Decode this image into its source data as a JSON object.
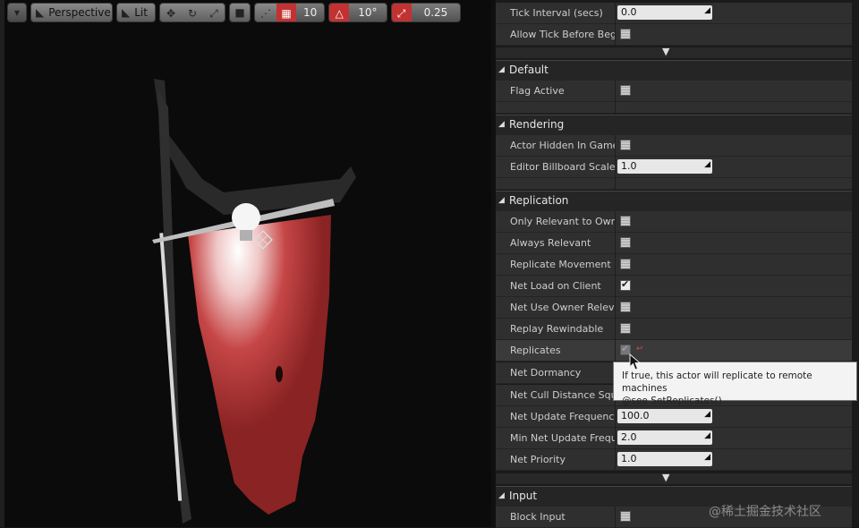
{
  "viewport": {
    "view_mode": "Perspective",
    "lit_mode": "Lit",
    "grid_snap": "10",
    "rotation_snap": "10°",
    "scale_snap": "0.25"
  },
  "details": {
    "top_rows": [
      {
        "label": "Tick Interval (secs)",
        "value": "0.0"
      },
      {
        "label": "Allow Tick Before Begin",
        "checked": false
      }
    ],
    "sections": {
      "default": {
        "title": "Default",
        "rows": [
          {
            "label": "Flag Active"
          }
        ]
      },
      "rendering": {
        "title": "Rendering",
        "rows": [
          {
            "label": "Actor Hidden In Game"
          },
          {
            "label": "Editor Billboard Scale",
            "value": "1.0"
          }
        ]
      },
      "replication": {
        "title": "Replication",
        "rows": [
          {
            "label": "Only Relevant to Owner"
          },
          {
            "label": "Always Relevant"
          },
          {
            "label": "Replicate Movement"
          },
          {
            "label": "Net Load on Client",
            "checked": true
          },
          {
            "label": "Net Use Owner Relevancy"
          },
          {
            "label": "Replay Rewindable"
          },
          {
            "label": "Replicates",
            "checked": true
          },
          {
            "label": "Net Dormancy"
          },
          {
            "label": "Net Cull Distance Squared"
          },
          {
            "label": "Net Update Frequency",
            "value": "100.0"
          },
          {
            "label": "Min Net Update Frequency",
            "value": "2.0"
          },
          {
            "label": "Net Priority",
            "value": "1.0"
          }
        ]
      },
      "input": {
        "title": "Input",
        "rows": [
          {
            "label": "Block Input"
          }
        ]
      }
    }
  },
  "tooltip": {
    "line1": "If true, this actor will replicate to remote machines",
    "line2": "@see SetReplicates()"
  },
  "watermark": "@稀土掘金技术社区",
  "colors": {
    "accent_red": "#c23232",
    "banner_red": "#b53a3a",
    "panel_bg": "#2f2f2f"
  }
}
